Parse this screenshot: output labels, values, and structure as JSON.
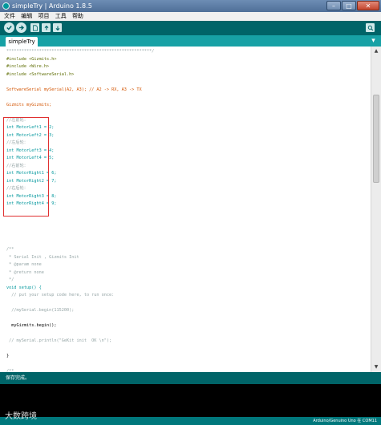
{
  "window": {
    "title": "simpleTry | Arduino 1.8.5",
    "controls": {
      "minimize": "–",
      "maximize": "□",
      "close": "✕"
    }
  },
  "menu": [
    "文件",
    "编辑",
    "项目",
    "工具",
    "帮助"
  ],
  "toolbar": {
    "icons": [
      "verify-icon",
      "upload-icon",
      "new-icon",
      "open-icon",
      "save-icon",
      "serial-monitor-icon"
    ]
  },
  "tabs": [
    {
      "label": "simpleTry"
    }
  ],
  "editor": {
    "lines": [
      "**********************************************************/",
      "#include <Gizmits.h>",
      "#include <Wire.h>",
      "#include <SoftwareSerial.h>",
      "",
      "SoftwareSerial mySerial(A2, A3); // A2 -> RX, A3 -> TX",
      "",
      "Gizmits myGizmits;",
      "",
      "//左前轮：",
      "int MotorLeft1 = 2;",
      "int MotorLeft2 = 3;",
      "//左后轮：",
      "int MotorLeft3 = 4;",
      "int MotorLeft4 = 5;",
      "//右前轮：",
      "int MotorRight1 = 6;",
      "int MotorRight2 = 7;",
      "//右后轮：",
      "int MotorRight3 = 8;",
      "int MotorRight4 = 9;",
      "",
      "",
      "",
      "",
      "",
      "/**",
      " * Serial Init , Gizmits Init",
      " * @param none",
      " * @return none",
      " */",
      "void setup() {",
      "  // put your setup code here, to run once:",
      "",
      "  //mySerial.begin(115200);",
      "",
      "  myGizmits.begin();",
      "",
      " // mySerial.println(\"GeKit init  OK \\n\");",
      "",
      "}",
      "",
      "/**"
    ]
  },
  "status": {
    "message": "保存完成。"
  },
  "footer": {
    "board": "Arduino/Genuino Uno 在 COM11"
  },
  "watermark": "大数跨境"
}
